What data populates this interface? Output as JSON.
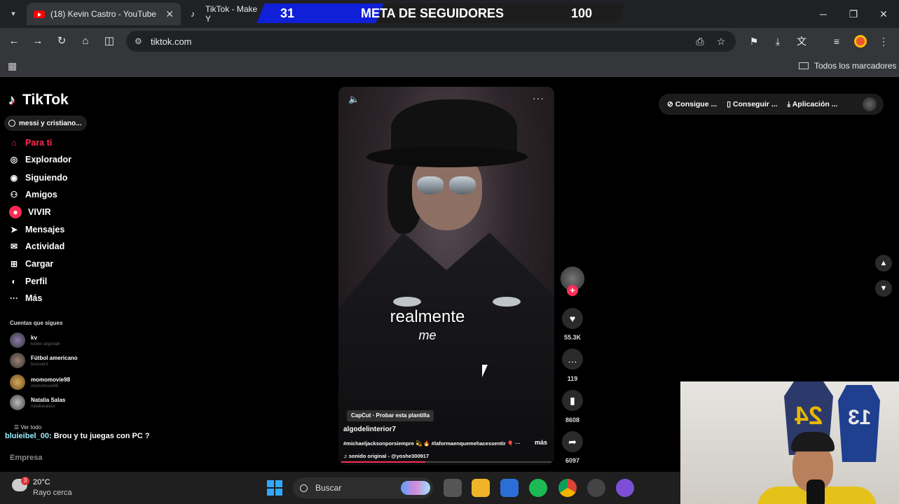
{
  "browser": {
    "tabs": [
      {
        "title": "(18) Kevin Castro - YouTube"
      },
      {
        "title": "TikTok - Make Y"
      }
    ],
    "url": "tiktok.com",
    "bookmarks_all": "Todos los marcadores"
  },
  "banner": {
    "current": "31",
    "title": "META DE SEGUIDORES",
    "goal": "100"
  },
  "tiktok": {
    "logo": "TikTok",
    "search_placeholder": "messi y cristiano...",
    "nav": [
      {
        "label": "Para ti",
        "icon": "home-icon",
        "active": true
      },
      {
        "label": "Explorador",
        "icon": "compass-icon"
      },
      {
        "label": "Siguiendo",
        "icon": "following-icon"
      },
      {
        "label": "Amigos",
        "icon": "friends-icon"
      },
      {
        "label": "VIVIR",
        "icon": "live-icon"
      },
      {
        "label": "Mensajes",
        "icon": "messages-icon"
      },
      {
        "label": "Actividad",
        "icon": "activity-icon"
      },
      {
        "label": "Cargar",
        "icon": "upload-icon"
      },
      {
        "label": "Perfil",
        "icon": "profile-icon"
      },
      {
        "label": "Más",
        "icon": "more-icon"
      }
    ],
    "following_title": "Cuentas que sigues",
    "following": [
      {
        "name": "kv",
        "handle": "keiver.segovia6"
      },
      {
        "name": "Fútbol americano",
        "handle": "bsoccer3"
      },
      {
        "name": "momomovie98",
        "handle": "momomovie98"
      },
      {
        "name": "Natalia Salas",
        "handle": "nataliasalasv"
      }
    ],
    "see_all": "Ver todo",
    "chat": {
      "user": "bluieibel_00",
      "message": ": Brou y tu juegas con PC ?"
    },
    "empresa": "Empresa",
    "video": {
      "caption": "realmente",
      "caption_sub": "me",
      "capcut": "CapCut · Probar esta plantilla",
      "username": "algodelinterior7",
      "hashtags": "#michaeljacksonporsiempre 💫 🔥 #laformaenquemehacessentir 🎈 ···",
      "more": "más",
      "sound": "sonido original - @yoshe300917"
    },
    "actions": {
      "likes": "55.3K",
      "comments": "119",
      "saves": "8608",
      "shares": "6097"
    },
    "top_right": [
      "Consigue ...",
      "Conseguir ...",
      "Aplicación ..."
    ]
  },
  "taskbar": {
    "temperature": "20°C",
    "weather": "Rayo cerca",
    "search": "Buscar"
  },
  "webcam": {
    "jersey1_number": "24",
    "jersey2_number": "13"
  }
}
